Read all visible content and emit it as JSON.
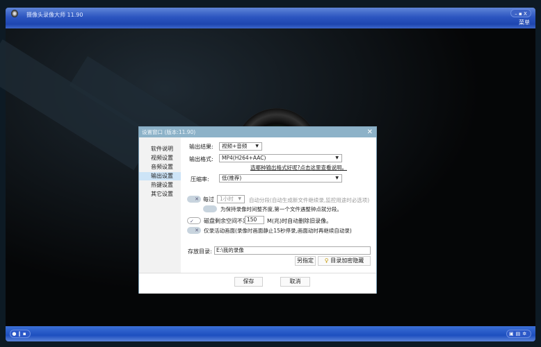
{
  "app": {
    "title": "摄像头录像大师 11.90",
    "menu": "菜单",
    "window_controls": [
      "minimize",
      "maximize",
      "close"
    ]
  },
  "bottom": {
    "left_controls": [
      "record-icon",
      "pause-icon",
      "stop-icon"
    ],
    "right_controls": [
      "lock-icon",
      "screen-icon",
      "gear-icon"
    ]
  },
  "dialog": {
    "title": "设置窗口 (版本:11.90)",
    "sidebar": [
      "软件说明",
      "视频设置",
      "音频设置",
      "输出设置",
      "热键设置",
      "其它设置"
    ],
    "active_index": 3,
    "output_result_label": "输出结果:",
    "output_result_value": "视频+音频",
    "output_format_label": "输出格式:",
    "output_format_value": "MP4(H264+AAC)",
    "format_help_link": "选哪种输出格式好呢?点击这里查看说明。",
    "compression_label": "压缩率:",
    "compression_value": "低(推荐)",
    "split_every_label": "每过",
    "split_every_value": "1小时",
    "split_desc": "自动分段(自动生成新文件继续录,监控用途时必选项)",
    "align_split_label": "为保持录像时间整齐度,第一个文件遇整钟点就分段。",
    "disk_label_pre": "磁盘剩余空间不足",
    "disk_value": "150",
    "disk_label_post": "M(兆)时自动删除旧录像。",
    "motion_label": "仅录活动画面(录像时画面静止15秒停录,画面动时再继续自动录)",
    "save_dir_label": "存放目录:",
    "save_dir_value": "E:\\我的录像",
    "browse_button": "另指定",
    "encrypt_button": "目录加密隐藏",
    "save_button": "保存",
    "cancel_button": "取消",
    "toggles": {
      "split": false,
      "align": false,
      "disk": true,
      "motion": false
    }
  }
}
